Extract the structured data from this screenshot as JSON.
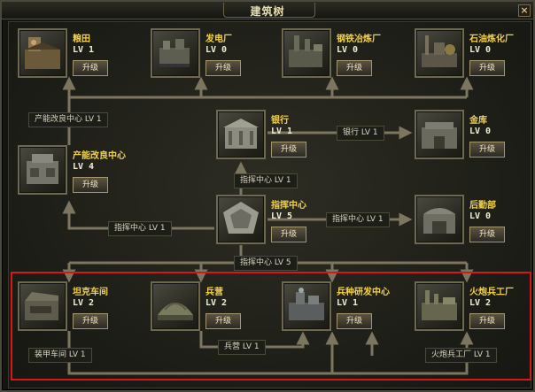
{
  "window": {
    "title": "建筑树",
    "close_glyph": "×"
  },
  "colors": {
    "connector": "#7c7660",
    "name_text": "#f2d24a",
    "highlight": "#d5181a"
  },
  "buildings": {
    "farm": {
      "name": "粮田",
      "level": "LV 1",
      "upgrade": "升级",
      "icon": "farm-icon"
    },
    "power_plant": {
      "name": "发电厂",
      "level": "LV 0",
      "upgrade": "升级",
      "icon": "power-plant-icon"
    },
    "steel_mill": {
      "name": "钢铁冶炼厂",
      "level": "LV 0",
      "upgrade": "升级",
      "icon": "steel-mill-icon"
    },
    "refinery": {
      "name": "石油炼化厂",
      "level": "LV 0",
      "upgrade": "升级",
      "icon": "oil-refinery-icon"
    },
    "bank": {
      "name": "银行",
      "level": "LV 1",
      "upgrade": "升级",
      "icon": "bank-icon"
    },
    "treasury": {
      "name": "金库",
      "level": "LV 0",
      "upgrade": "升级",
      "icon": "treasury-icon"
    },
    "prod_center": {
      "name": "产能改良中心",
      "level": "LV 4",
      "upgrade": "升级",
      "icon": "production-center-icon"
    },
    "command": {
      "name": "指挥中心",
      "level": "LV 5",
      "upgrade": "升级",
      "icon": "command-center-icon"
    },
    "logistics": {
      "name": "后勤部",
      "level": "LV 0",
      "upgrade": "升级",
      "icon": "logistics-icon"
    },
    "tank_shop": {
      "name": "坦克车间",
      "level": "LV 2",
      "upgrade": "升级",
      "icon": "tank-workshop-icon"
    },
    "barracks": {
      "name": "兵营",
      "level": "LV 2",
      "upgrade": "升级",
      "icon": "barracks-icon"
    },
    "research": {
      "name": "兵种研发中心",
      "level": "LV 1",
      "upgrade": "升级",
      "icon": "research-center-icon"
    },
    "artillery": {
      "name": "火炮兵工厂",
      "level": "LV 2",
      "upgrade": "升级",
      "icon": "artillery-factory-icon"
    }
  },
  "requirements": {
    "prod_center_lv1": "产能改良中心  LV 1",
    "bank_lv1": "银行  LV 1",
    "command_lv1": "指挥中心  LV 1",
    "command_lv1_left": "指挥中心  LV 1",
    "command_lv1_right": "指挥中心  LV 1",
    "command_lv5": "指挥中心  LV 5",
    "armor_lv1": "装甲车间  LV 1",
    "barracks_lv1": "兵营  LV 1",
    "artillery_lv1": "火炮兵工厂  LV 1"
  }
}
